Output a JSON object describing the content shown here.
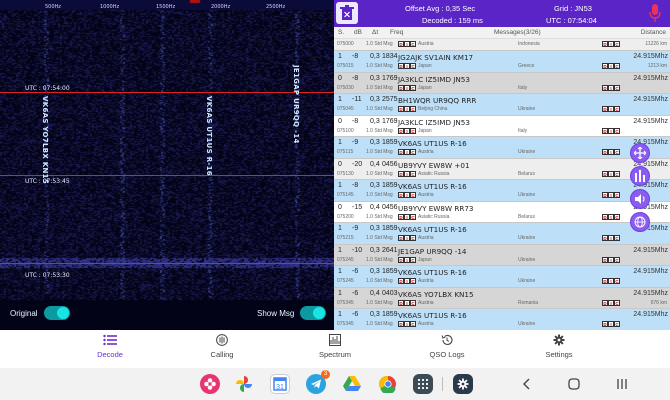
{
  "waterfall": {
    "freq_ticks": [
      "500Hz",
      "1000Hz",
      "1500Hz",
      "2000Hz",
      "2500Hz"
    ],
    "utc_markers": [
      "UTC : 07:54:00",
      "UTC : 07:53:45",
      "UTC : 07:53:30"
    ],
    "vertical_labels": [
      "VK6AS YO7LBX KN15",
      "VK6AS UT1US R-16",
      "JE1GAP UR9QQ -14"
    ],
    "original_label": "Original",
    "showmsg_label": "Show Msg"
  },
  "topbar": {
    "offset": "Offset Avg : 0,35 Sec",
    "decoded": "Decoded : 159 ms",
    "grid": "Grid : JN53",
    "utc": "UTC : 07:54:04",
    "trash_icon": "trash-icon",
    "mic_icon": "microphone-icon"
  },
  "columns": {
    "s": "S.",
    "db": "dB",
    "dt": "Δt",
    "freq": "Freq",
    "messages": "Messages(3/26)",
    "distance": "Distance"
  },
  "top_partial_row": {
    "time": "075000",
    "mode": "1.0 Std Msg",
    "country_left": "Austria",
    "country_mid": "Indonesia",
    "dist": "11226 km"
  },
  "rows": [
    {
      "s": "1",
      "db": "-8",
      "dt": "0,3",
      "freq": "1834",
      "msg": "JG2AJK SV1AIN KM17",
      "dist": "24.915Mhz",
      "time": "075015",
      "mode": "1.0 Std Msg",
      "cl": "Japan",
      "cm": "Greece",
      "cr": "1213 km",
      "bg": "bluebg"
    },
    {
      "s": "0",
      "db": "-8",
      "dt": "0,3",
      "freq": "1769",
      "msg": "JA3KLC IZ5IMD JN53",
      "dist": "24.915Mhz",
      "time": "075030",
      "mode": "1.0 Std Msg",
      "cl": "Japan",
      "cm": "Italy",
      "cr": "",
      "bg": "greybg"
    },
    {
      "s": "1",
      "db": "-11",
      "dt": "0,3",
      "freq": "2575",
      "msg": "BH1WQR UR9QQ RRR",
      "dist": "24.915Mhz",
      "time": "075045",
      "mode": "1.0 Std Msg",
      "cl": "Beijing China",
      "cm": "Ukraine",
      "cr": "",
      "bg": "bluebg"
    },
    {
      "s": "0",
      "db": "-8",
      "dt": "0,3",
      "freq": "1769",
      "msg": "JA3KLC IZ5IMD JN53",
      "dist": "24.915Mhz",
      "time": "075100",
      "mode": "1.0 Std Msg",
      "cl": "Japan",
      "cm": "Italy",
      "cr": "",
      "bg": "whitebg"
    },
    {
      "s": "1",
      "db": "-9",
      "dt": "0,3",
      "freq": "1859",
      "msg": "VK6AS UT1US R-16",
      "dist": "24.915Mhz",
      "time": "075115",
      "mode": "1.0 Std Msg",
      "cl": "Austria",
      "cm": "Ukraine",
      "cr": "",
      "bg": "bluebg"
    },
    {
      "s": "0",
      "db": "-20",
      "dt": "0,4",
      "freq": "0456",
      "msg": "UB9YVY EW8W +01",
      "dist": "24.915Mhz",
      "time": "075130",
      "mode": "1.0 Std Msg",
      "cl": "Asiatic Russia",
      "cm": "Belarus",
      "cr": "",
      "bg": "lightbg"
    },
    {
      "s": "1",
      "db": "-8",
      "dt": "0,3",
      "freq": "1859",
      "msg": "VK6AS UT1US R-16",
      "dist": "24.915Mhz",
      "time": "075145",
      "mode": "1.0 Std Msg",
      "cl": "Austria",
      "cm": "Ukraine",
      "cr": "",
      "bg": "bluebg"
    },
    {
      "s": "0",
      "db": "-15",
      "dt": "0,4",
      "freq": "0456",
      "msg": "UB9YVY EW8W RR73",
      "dist": "24.915Mhz",
      "time": "075200",
      "mode": "1.0 Std Msg",
      "cl": "Asiatic Russia",
      "cm": "Belarus",
      "cr": "",
      "bg": "whitebg"
    },
    {
      "s": "1",
      "db": "-9",
      "dt": "0,3",
      "freq": "1859",
      "msg": "VK6AS UT1US R-16",
      "dist": "24.915Mhz",
      "time": "075215",
      "mode": "1.0 Std Msg",
      "cl": "Austria",
      "cm": "Ukraine",
      "cr": "",
      "bg": "bluebg"
    },
    {
      "s": "1",
      "db": "-10",
      "dt": "0,3",
      "freq": "2641",
      "msg": "JE1GAP UR9QQ -14",
      "dist": "24.915Mhz",
      "time": "075245",
      "mode": "1.0 Std Msg",
      "cl": "Japan",
      "cm": "Ukraine",
      "cr": "",
      "bg": "greybg"
    },
    {
      "s": "1",
      "db": "-6",
      "dt": "0,3",
      "freq": "1859",
      "msg": "VK6AS UT1US R-16",
      "dist": "24.915Mhz",
      "time": "075245",
      "mode": "1.0 Std Msg",
      "cl": "Austria",
      "cm": "Ukraine",
      "cr": "",
      "bg": "bluebg"
    },
    {
      "s": "1",
      "db": "-6",
      "dt": "0,4",
      "freq": "0403",
      "msg": "VK6AS YO7LBX KN15",
      "dist": "24.915Mhz",
      "time": "075345",
      "mode": "1.0 Std Msg",
      "cl": "Austria",
      "cm": "Romania",
      "cr": "976 km",
      "bg": "greybg"
    },
    {
      "s": "1",
      "db": "-6",
      "dt": "0,3",
      "freq": "1859",
      "msg": "VK6AS UT1US R-16",
      "dist": "24.915Mhz",
      "time": "075345",
      "mode": "1.0 Std Msg",
      "cl": "Austria",
      "cm": "Ukraine",
      "cr": "",
      "bg": "bluebg"
    },
    {
      "s": "1",
      "db": "-11",
      "dt": "0,3",
      "freq": "2641",
      "msg": "JE1GAP UR9QQ -14",
      "dist": "24.915Mhz",
      "time": "075315",
      "mode": "1.0 Std Msg",
      "cl": "Japan",
      "cm": "Ukraine",
      "cr": "",
      "bg": "greybg"
    }
  ],
  "side_icons": [
    "move-icon",
    "equalizer-icon",
    "volume-icon",
    "globe-icon"
  ],
  "nav": [
    {
      "label": "Decode",
      "icon": "list-icon",
      "active": true
    },
    {
      "label": "Calling",
      "icon": "calling-icon",
      "active": false
    },
    {
      "label": "Spectrum",
      "icon": "spectrum-icon",
      "active": false
    },
    {
      "label": "QSO Logs",
      "icon": "history-icon",
      "active": false
    },
    {
      "label": "Settings",
      "icon": "gear-icon",
      "active": false
    }
  ],
  "dock": {
    "telegram_badge": "3",
    "apps": [
      "flower-app-icon",
      "photos-icon",
      "calendar-icon",
      "telegram-icon",
      "drive-icon",
      "chrome-icon",
      "apps-grid-icon",
      "settings-app-icon"
    ]
  },
  "colors": {
    "accent": "#5b24c7",
    "row_blue": "#bde0f8",
    "row_grey": "#d6d6d6",
    "waterfall_bg": "#030318",
    "utc_line": "#dd2222"
  }
}
